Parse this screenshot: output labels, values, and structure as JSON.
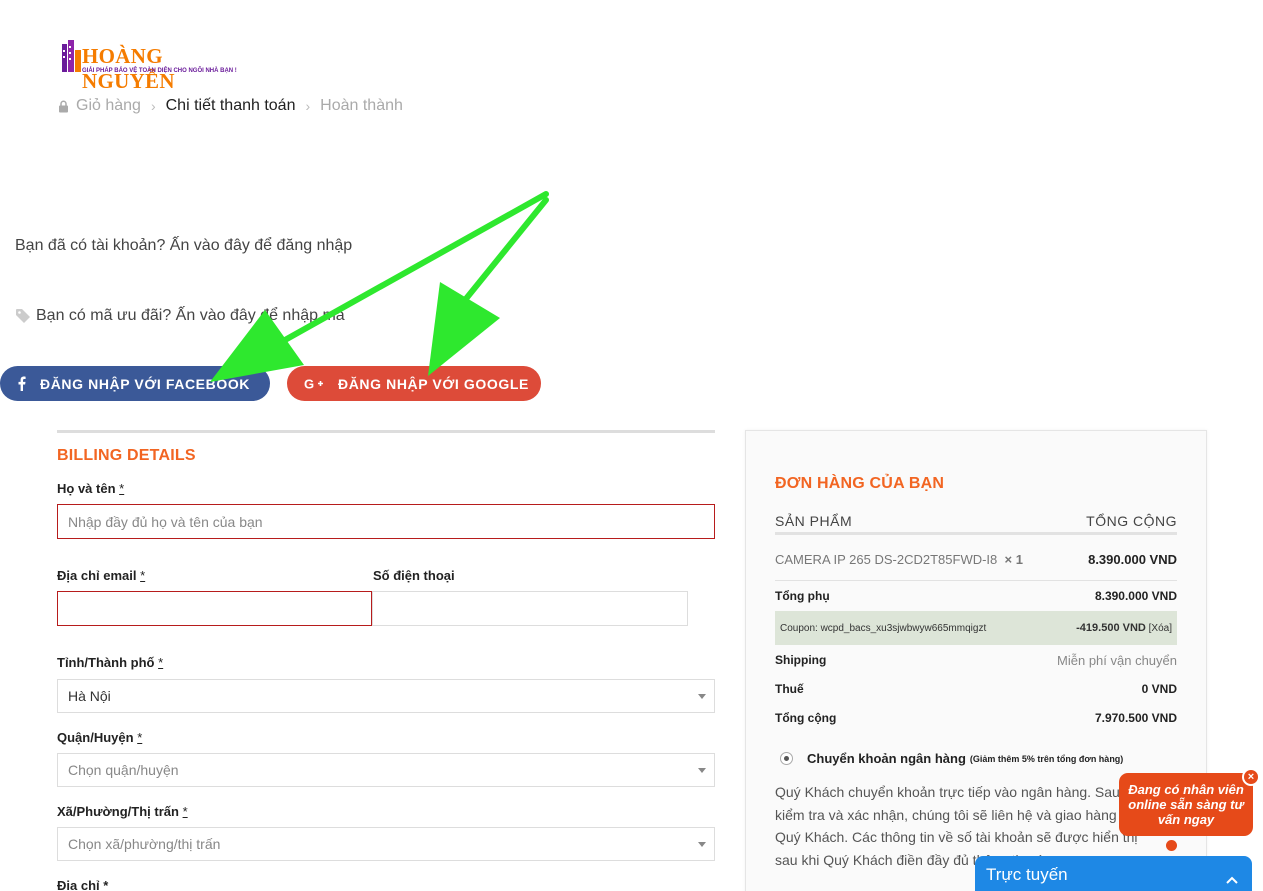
{
  "logo": {
    "brand": "HOÀNG NGUYỄN",
    "tagline": "GIẢI PHÁP BẢO VỆ TOÀN DIỆN CHO NGÔI NHÀ BẠN !"
  },
  "breadcrumb": {
    "items": [
      "Giỏ hàng",
      "Chi tiết thanh toán",
      "Hoàn thành"
    ],
    "separator": "›"
  },
  "notices": {
    "login": "Bạn đã có tài khoản? Ấn vào đây để đăng nhập",
    "coupon": "Bạn có mã ưu đãi? Ấn vào đây để nhập mã"
  },
  "social": {
    "facebook_label": "ĐĂNG NHẬP VỚI FACEBOOK",
    "google_label": "ĐĂNG NHẬP VỚI GOOGLE",
    "facebook_color": "#3b5998",
    "google_color": "#dd4b39"
  },
  "billing": {
    "title": "BILLING DETAILS",
    "fullname_label": "Họ và tên",
    "fullname_placeholder": "Nhập đầy đủ họ và tên của bạn",
    "email_label": "Địa chỉ email",
    "phone_label": "Số điện thoại",
    "city_label": "Tỉnh/Thành phố",
    "city_value": "Hà Nội",
    "district_label": "Quận/Huyện",
    "district_value": "Chọn quận/huyện",
    "ward_label": "Xã/Phường/Thị trấn",
    "ward_value": "Chọn xã/phường/thị trấn",
    "address_label": "Địa chỉ",
    "required_mark": "*"
  },
  "order": {
    "title": "ĐƠN HÀNG CỦA BẠN",
    "col_product": "SẢN PHẨM",
    "col_total": "TỔNG CỘNG",
    "product_name": "CAMERA IP 265 DS-2CD2T85FWD-I8",
    "product_qty": "× 1",
    "product_price": "8.390.000 VND",
    "subtotal_label": "Tổng phụ",
    "subtotal_value": "8.390.000 VND",
    "coupon_label": "Coupon: wcpd_bacs_xu3sjwbwyw665mmqigzt",
    "coupon_value": "-419.500 VND",
    "coupon_remove": "[Xóa]",
    "shipping_label": "Shipping",
    "shipping_value": "Miễn phí vận chuyển",
    "tax_label": "Thuế",
    "tax_value": "0 VND",
    "total_label": "Tổng cộng",
    "total_value": "7.970.500 VND",
    "payment_label": "Chuyển khoản ngân hàng",
    "payment_note": "(Giảm thêm 5% trên tổng đơn hàng)",
    "payment_desc": "Quý Khách chuyển khoản trực tiếp vào ngân hàng. Sau khi kiểm tra và xác nhận, chúng tôi sẽ liên hệ và giao hàng cho Quý Khách. Các thông tin về số tài khoản sẽ được hiển thị sau khi Quý Khách điền đầy đủ thông tin và"
  },
  "chat": {
    "bubble": "Đang có nhân viên online sẵn sàng tư vấn ngay",
    "bar_label": "Trực tuyến",
    "close": "×",
    "accent": "#e64a19",
    "bar_color": "#1e88e5"
  },
  "annotation_color": "#2ee82e"
}
